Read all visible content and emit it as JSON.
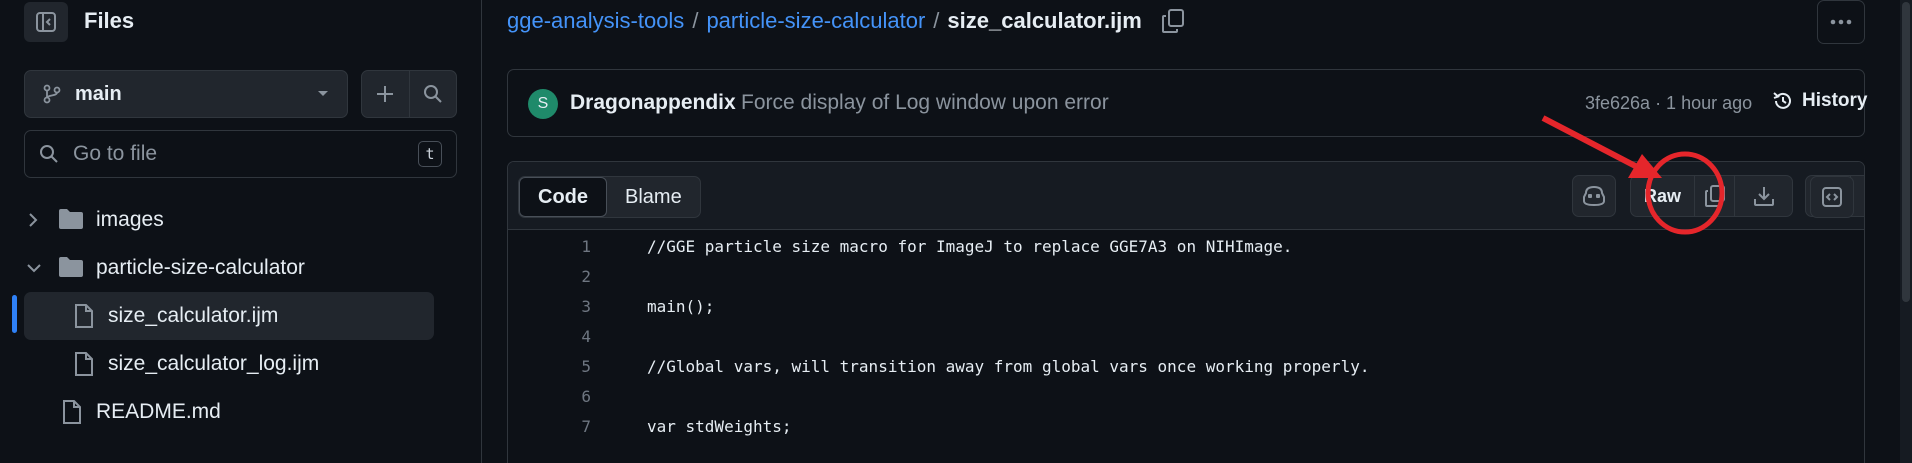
{
  "sidebar": {
    "title": "Files",
    "branch": "main",
    "goto_placeholder": "Go to file",
    "goto_shortcut": "t",
    "tree": [
      {
        "label": "images",
        "type": "folder",
        "expanded": false
      },
      {
        "label": "particle-size-calculator",
        "type": "folder",
        "expanded": true
      },
      {
        "label": "size_calculator.ijm",
        "type": "file",
        "selected": true
      },
      {
        "label": "size_calculator_log.ijm",
        "type": "file"
      },
      {
        "label": "README.md",
        "type": "file"
      }
    ]
  },
  "breadcrumb": {
    "repo": "gge-analysis-tools",
    "folder": "particle-size-calculator",
    "file": "size_calculator.ijm",
    "separator": "/"
  },
  "commit": {
    "avatar_initial": "S",
    "author": "Dragonappendix",
    "message": "Force display of Log window upon error",
    "sha_time": "3fe626a · 1 hour ago",
    "history_label": "History"
  },
  "file_header": {
    "tabs": [
      "Code",
      "Blame"
    ],
    "active_tab": "Code",
    "raw_label": "Raw"
  },
  "code": {
    "lines": [
      {
        "n": "1",
        "text": "//GGE particle size macro for ImageJ to replace GGE7A3 on NIHImage."
      },
      {
        "n": "2",
        "text": ""
      },
      {
        "n": "3",
        "text": "main();"
      },
      {
        "n": "4",
        "text": ""
      },
      {
        "n": "5",
        "text": "//Global vars, will transition away from global vars once working properly."
      },
      {
        "n": "6",
        "text": ""
      },
      {
        "n": "7",
        "text": "var stdWeights;"
      }
    ]
  },
  "colors": {
    "background": "#0d1117",
    "link": "#4493f8",
    "annotation": "#e5262b",
    "active_indicator": "#2f81f7"
  },
  "icons": {
    "sidebar_toggle": "sidebar-collapse-icon",
    "branch": "git-branch-icon",
    "add": "plus-icon",
    "search": "search-icon",
    "folder": "folder-icon",
    "file": "file-icon",
    "copy": "copy-icon",
    "history": "history-icon",
    "copilot": "copilot-icon",
    "download": "download-icon",
    "edit": "pencil-icon",
    "symbols": "code-square-icon"
  }
}
